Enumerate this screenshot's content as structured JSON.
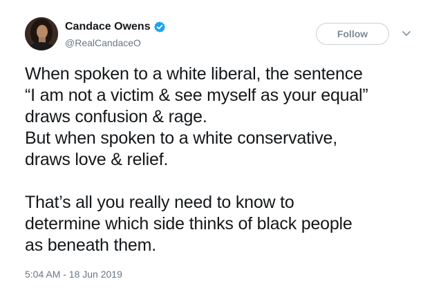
{
  "author": {
    "display_name": "Candace Owens",
    "handle": "@RealCandaceO",
    "verified_icon": "verified-badge-icon"
  },
  "actions": {
    "follow_label": "Follow",
    "more_icon": "chevron-down-icon"
  },
  "tweet": {
    "lines": [
      "When spoken to a white liberal, the sentence",
      "“I am not a victim & see myself as your equal”",
      "draws confusion & rage.",
      "But when spoken to a white conservative,",
      "draws love & relief.",
      "",
      "That’s all you really need to know to",
      "determine which side thinks of black people",
      "as beneath them."
    ],
    "timestamp": "5:04 AM - 18 Jun 2019"
  },
  "colors": {
    "verified_blue": "#1da1f2",
    "text_primary": "#14171a",
    "text_secondary": "#657786",
    "button_border": "#c9d0d6"
  }
}
